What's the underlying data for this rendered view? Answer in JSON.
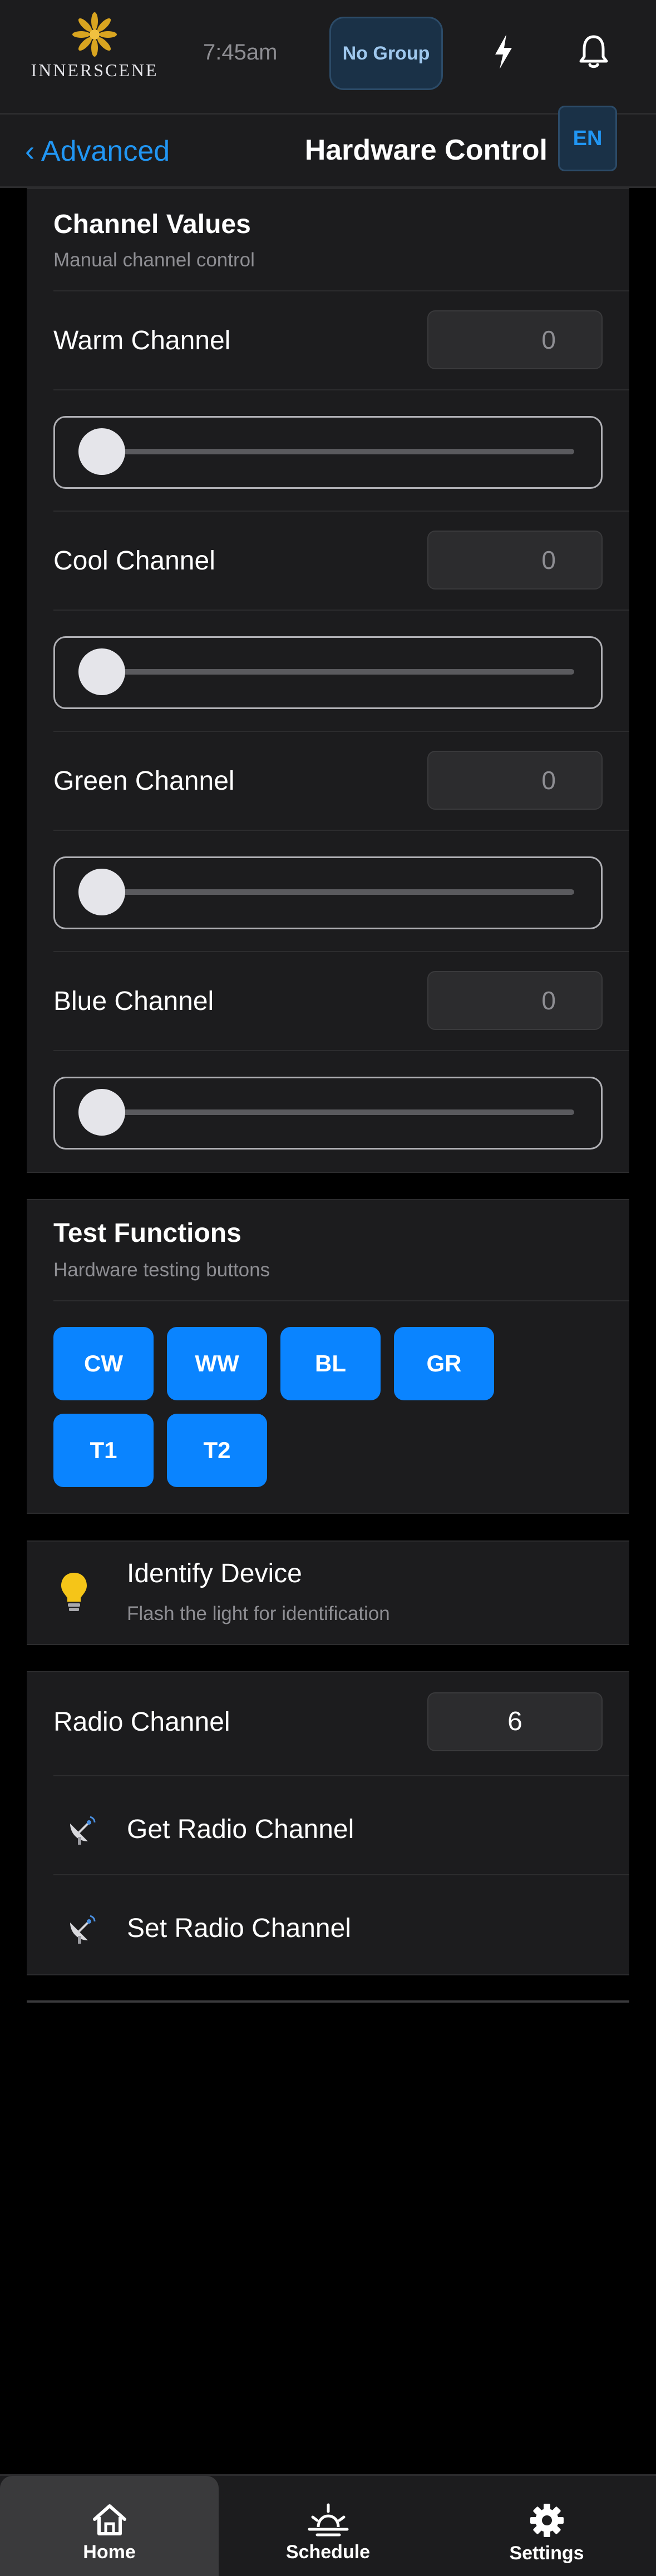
{
  "header": {
    "logo_text": "INNERSCENE",
    "time": "7:45am",
    "group_button": "No Group"
  },
  "nav": {
    "back_label": "‹ Advanced",
    "title": "Hardware Control",
    "language": "EN"
  },
  "channel_values": {
    "title": "Channel Values",
    "subtitle": "Manual channel control",
    "channels": [
      {
        "label": "Warm Channel",
        "value": "0",
        "slider_fraction": 0
      },
      {
        "label": "Cool Channel",
        "value": "0",
        "slider_fraction": 0
      },
      {
        "label": "Green Channel",
        "value": "0",
        "slider_fraction": 0
      },
      {
        "label": "Blue Channel",
        "value": "0",
        "slider_fraction": 0
      }
    ]
  },
  "test_functions": {
    "title": "Test Functions",
    "subtitle": "Hardware testing buttons",
    "buttons": [
      "CW",
      "WW",
      "BL",
      "GR",
      "T1",
      "T2"
    ]
  },
  "identify": {
    "title": "Identify Device",
    "subtitle": "Flash the light for identification",
    "icon": "lightbulb-icon"
  },
  "radio": {
    "label": "Radio Channel",
    "value": "6",
    "get_label": "Get Radio Channel",
    "set_label": "Set Radio Channel",
    "icon": "satellite-icon"
  },
  "tabs": [
    {
      "label": "Home",
      "icon": "home-icon",
      "active": true
    },
    {
      "label": "Schedule",
      "icon": "sunrise-icon",
      "active": false
    },
    {
      "label": "Settings",
      "icon": "gear-icon",
      "active": false
    }
  ],
  "colors": {
    "accent": "#0a84ff",
    "link": "#2196f3",
    "background": "#000000",
    "card": "#1c1c1e"
  }
}
